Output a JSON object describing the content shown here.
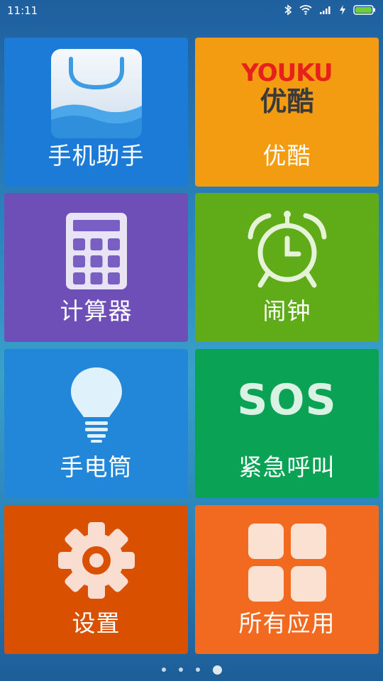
{
  "status_bar": {
    "time": "11:11",
    "icons": [
      "bluetooth-icon",
      "wifi-icon",
      "signal-icon",
      "charging-icon",
      "battery-icon"
    ]
  },
  "tiles": [
    {
      "label": "手机助手",
      "icon": "app-store-bag-icon",
      "color": "#1d7bd8"
    },
    {
      "label": "优酷",
      "icon": "youku-logo",
      "color": "#f39c12",
      "logo_text_en": "YOUKU",
      "logo_text_cn": "优酷"
    },
    {
      "label": "计算器",
      "icon": "calculator-icon",
      "color": "#6e4fb7"
    },
    {
      "label": "闹钟",
      "icon": "alarm-clock-icon",
      "color": "#5fab18"
    },
    {
      "label": "手电筒",
      "icon": "lightbulb-icon",
      "color": "#2387d9"
    },
    {
      "label": "紧急呼叫",
      "icon": "sos-icon",
      "color": "#0aa356",
      "icon_text": "SOS"
    },
    {
      "label": "设置",
      "icon": "gear-icon",
      "color": "#d95000"
    },
    {
      "label": "所有应用",
      "icon": "all-apps-grid-icon",
      "color": "#f26a20"
    }
  ],
  "pagination": {
    "total": 4,
    "active_index": 3
  }
}
